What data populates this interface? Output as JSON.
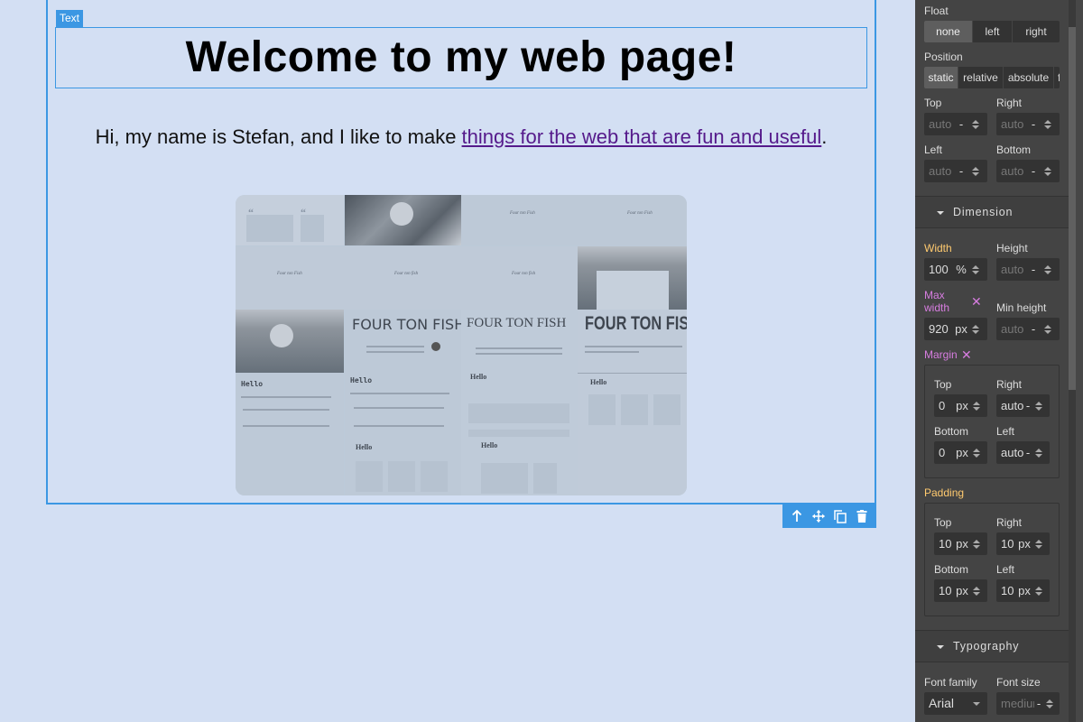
{
  "canvas": {
    "selected_badge": "Text",
    "heading": "Welcome to my web page!",
    "paragraph_prefix": "Hi, my name is Stefan, and I like to make ",
    "paragraph_link": "things for the web that are fun and useful",
    "paragraph_suffix": ".",
    "preview_titles": [
      "FOUR TON FISH",
      "FOUR TON FISH",
      "FOUR TON FISH"
    ],
    "preview_hello": [
      "Hello",
      "Hello",
      "Hello",
      "Hello",
      "Hello",
      "Hello"
    ],
    "toolbar": {
      "icons": [
        "arrow-up-icon",
        "move-icon",
        "copy-icon",
        "delete-icon"
      ]
    }
  },
  "colors": {
    "selection": "#3b97e3",
    "link": "#551a8b",
    "panel_bg": "#444444",
    "label_set": "#ffca6f",
    "label_inherited": "#d77de0"
  },
  "panel": {
    "float": {
      "label": "Float",
      "options": [
        "none",
        "left",
        "right"
      ],
      "selected": "none"
    },
    "position": {
      "label": "Position",
      "options": [
        "static",
        "relative",
        "absolute",
        "fixed"
      ],
      "selected": "static",
      "top": {
        "label": "Top",
        "value": "auto",
        "unit": "-"
      },
      "right": {
        "label": "Right",
        "value": "auto",
        "unit": "-"
      },
      "left": {
        "label": "Left",
        "value": "auto",
        "unit": "-"
      },
      "bottom": {
        "label": "Bottom",
        "value": "auto",
        "unit": "-"
      }
    },
    "dimension": {
      "title": "Dimension",
      "width": {
        "label": "Width",
        "value": "100",
        "unit": "%"
      },
      "height": {
        "label": "Height",
        "value": "auto",
        "unit": "-"
      },
      "max_width": {
        "label": "Max width",
        "value": "920",
        "unit": "px"
      },
      "min_height": {
        "label": "Min height",
        "value": "auto",
        "unit": "-"
      },
      "margin": {
        "label": "Margin",
        "top": {
          "label": "Top",
          "value": "0",
          "unit": "px"
        },
        "right": {
          "label": "Right",
          "value": "auto",
          "unit": "-"
        },
        "bottom": {
          "label": "Bottom",
          "value": "0",
          "unit": "px"
        },
        "left": {
          "label": "Left",
          "value": "auto",
          "unit": "-"
        }
      },
      "padding": {
        "label": "Padding",
        "top": {
          "label": "Top",
          "value": "10",
          "unit": "px"
        },
        "right": {
          "label": "Right",
          "value": "10",
          "unit": "px"
        },
        "bottom": {
          "label": "Bottom",
          "value": "10",
          "unit": "px"
        },
        "left": {
          "label": "Left",
          "value": "10",
          "unit": "px"
        }
      }
    },
    "typography": {
      "title": "Typography",
      "font_family": {
        "label": "Font family",
        "value": "Arial"
      },
      "font_size": {
        "label": "Font size",
        "value": "medium",
        "unit": "-"
      }
    }
  }
}
